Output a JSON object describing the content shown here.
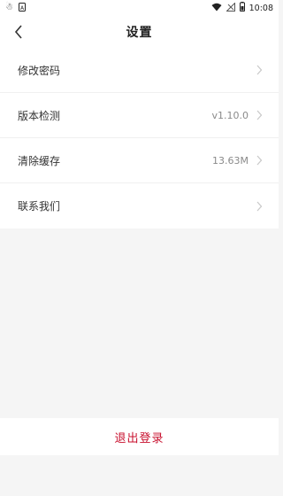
{
  "status_bar": {
    "left_icons": [
      "app-notification-icon",
      "sim-a-icon"
    ],
    "right_icons": [
      "wifi-icon",
      "signal-off-icon",
      "battery-icon"
    ],
    "time": "10:08"
  },
  "header": {
    "title": "设置",
    "back_icon": "chevron-left-icon"
  },
  "settings": {
    "items": [
      {
        "label": "修改密码",
        "value": ""
      },
      {
        "label": "版本检测",
        "value": "v1.10.0"
      },
      {
        "label": "清除缓存",
        "value": "13.63M"
      },
      {
        "label": "联系我们",
        "value": ""
      }
    ]
  },
  "logout": {
    "label": "退出登录"
  },
  "colors": {
    "accent": "#c8102e",
    "background": "#f5f5f5",
    "surface": "#ffffff",
    "muted_text": "#8a8a8a"
  }
}
